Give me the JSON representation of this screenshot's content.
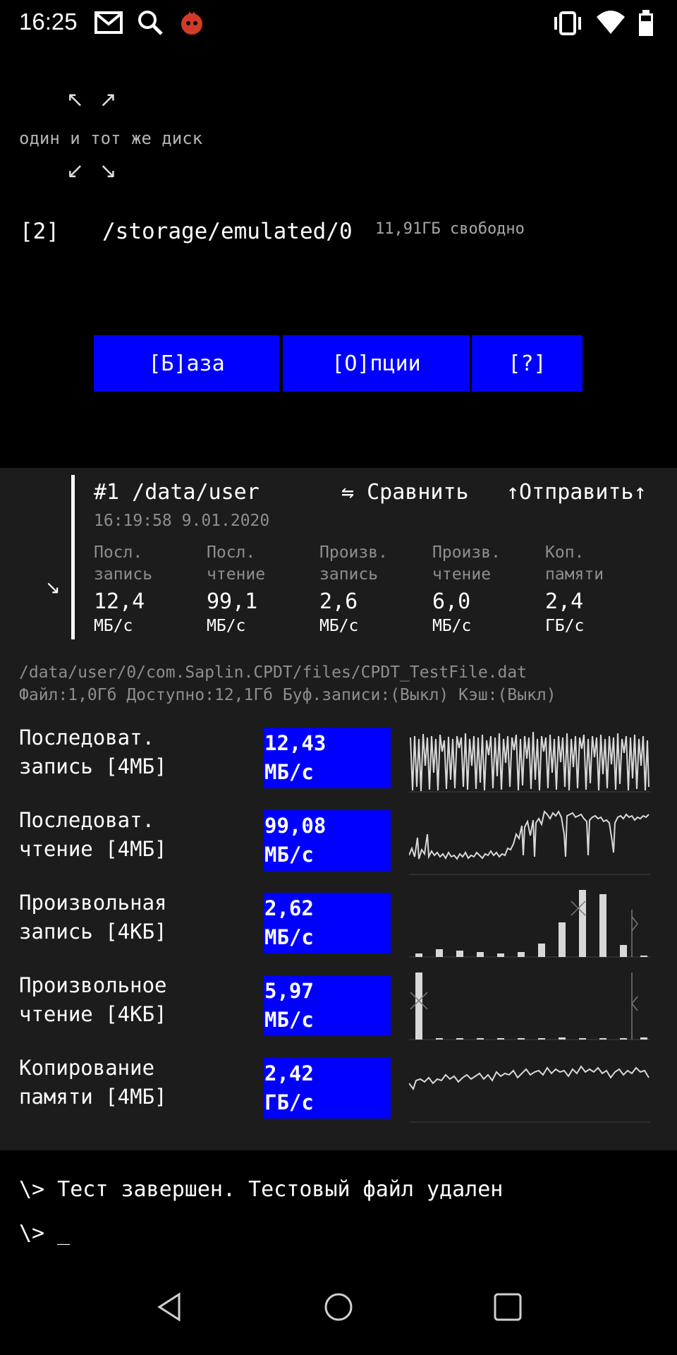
{
  "status_bar": {
    "time": "16:25",
    "left_icons": [
      "gmail-icon",
      "search-icon",
      "app-badge-icon"
    ],
    "right_icons": [
      "vibrate-icon",
      "wifi-icon",
      "battery-icon"
    ]
  },
  "disk": {
    "same_disk_label": "один и тот же диск",
    "index": "[2]",
    "path": "/storage/emulated/0",
    "free": "11,91ГБ свободно"
  },
  "menu": {
    "base": "[Б]аза",
    "options": "[О]пции",
    "help": "[?]"
  },
  "result": {
    "title": "#1 /data/user",
    "compare": "⇋ Сравнить",
    "send": "↑Отправить↑",
    "date": "16:19:58 9.01.2020",
    "metrics": [
      {
        "label": "Посл.\nзапись",
        "value": "12,4",
        "unit": "МБ/с"
      },
      {
        "label": "Посл.\nчтение",
        "value": "99,1",
        "unit": "МБ/с"
      },
      {
        "label": "Произв.\nзапись",
        "value": "2,6",
        "unit": "МБ/с"
      },
      {
        "label": "Произв.\nчтение",
        "value": "6,0",
        "unit": "МБ/с"
      },
      {
        "label": "Коп.\nпамяти",
        "value": "2,4",
        "unit": "ГБ/с"
      }
    ]
  },
  "file": {
    "path": "/data/user/0/com.Saplin.CPDT/files/CPDT_TestFile.dat",
    "info": "Файл:1,0Гб Доступно:12,1Гб Буф.записи:(Выкл) Кэш:(Выкл)"
  },
  "tests": [
    {
      "label": "Последоват.\nзапись [4МБ]",
      "value": "12,43",
      "unit": "МБ/с"
    },
    {
      "label": "Последоват.\nчтение [4МБ]",
      "value": "99,08",
      "unit": "МБ/с"
    },
    {
      "label": "Произвольная\nзапись [4КБ]",
      "value": "2,62",
      "unit": "МБ/с"
    },
    {
      "label": "Произвольное\nчтение [4КБ]",
      "value": "5,97",
      "unit": "МБ/с"
    },
    {
      "label": "Копирование\nпамяти [4МБ]",
      "value": "2,42",
      "unit": "ГБ/с"
    }
  ],
  "console": {
    "line1": "\\> Тест завершен. Тестовый файл удален",
    "line2": "\\> _"
  },
  "nav": [
    "back-icon",
    "home-icon",
    "recents-icon"
  ]
}
